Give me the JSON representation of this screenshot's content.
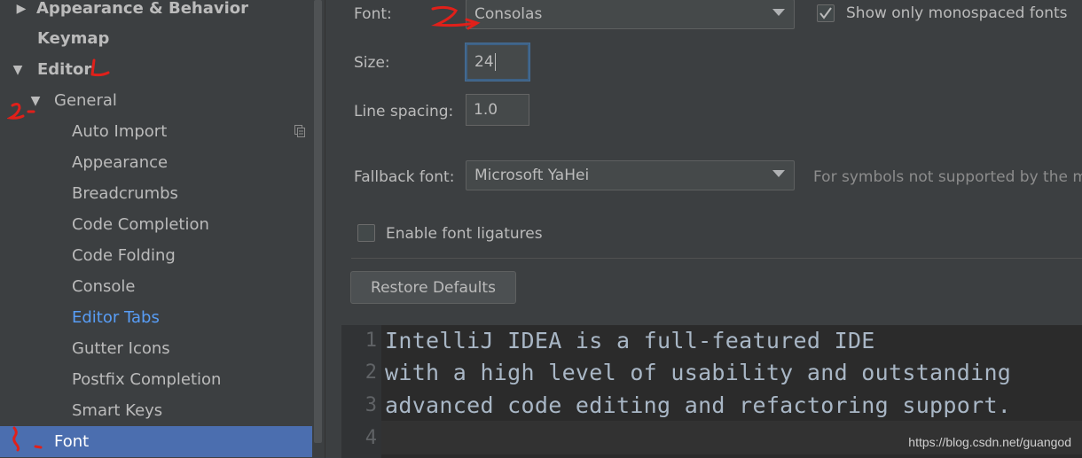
{
  "sidebar": {
    "items": [
      {
        "label": "Appearance & Behavior",
        "arrow": "▶"
      },
      {
        "label": "Keymap"
      },
      {
        "label": "Editor",
        "arrow": "▼"
      },
      {
        "label": "General",
        "arrow": "▼"
      },
      {
        "label": "Auto Import"
      },
      {
        "label": "Appearance"
      },
      {
        "label": "Breadcrumbs"
      },
      {
        "label": "Code Completion"
      },
      {
        "label": "Code Folding"
      },
      {
        "label": "Console"
      },
      {
        "label": "Editor Tabs"
      },
      {
        "label": "Gutter Icons"
      },
      {
        "label": "Postfix Completion"
      },
      {
        "label": "Smart Keys"
      },
      {
        "label": "Font"
      }
    ]
  },
  "font_settings": {
    "font_label": "Font:",
    "font_value": "Consolas",
    "mono_checkbox_label": "Show only monospaced fonts",
    "mono_checked": true,
    "size_label": "Size:",
    "size_value": "24",
    "line_spacing_label": "Line spacing:",
    "line_spacing_value": "1.0",
    "fallback_label": "Fallback font:",
    "fallback_value": "Microsoft YaHei",
    "fallback_hint": "For symbols not supported by the m",
    "ligatures_label": "Enable font ligatures",
    "ligatures_checked": false,
    "restore_label": "Restore Defaults"
  },
  "preview": {
    "lines": [
      {
        "num": "1",
        "text": "IntelliJ IDEA is a full-featured IDE"
      },
      {
        "num": "2",
        "text": "with a high level of usability and outstanding"
      },
      {
        "num": "3",
        "text": "advanced code editing and refactoring support."
      },
      {
        "num": "4",
        "text": ""
      }
    ]
  },
  "watermark": "https://blog.csdn.net/guangod",
  "colors": {
    "background": "#3c3f41",
    "selection": "#4b6eaf",
    "link": "#589df6",
    "annotation": "#e0201a"
  }
}
